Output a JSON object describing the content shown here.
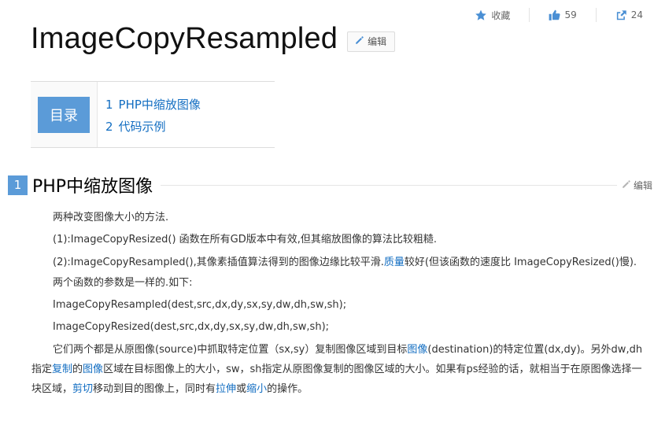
{
  "toolbar": {
    "collect_label": "收藏",
    "like_count": "59",
    "share_count": "24"
  },
  "title": "ImageCopyResampled",
  "edit_label": "编辑",
  "toc": {
    "label": "目录",
    "items": [
      {
        "num": "1",
        "text": "PHP中缩放图像"
      },
      {
        "num": "2",
        "text": "代码示例"
      }
    ]
  },
  "section": {
    "num": "1",
    "title": "PHP中缩放图像",
    "edit_label": "编辑"
  },
  "content": {
    "p1": "两种改变图像大小的方法.",
    "p2": "(1):ImageCopyResized() 函数在所有GD版本中有效,但其缩放图像的算法比较粗糙.",
    "p3a": "(2):ImageCopyResampled(),其像素插值算法得到的图像边缘比较平滑.",
    "p3_link": "质量",
    "p3b": "较好(但该函数的速度比 ImageCopyResized()慢).",
    "p4": "两个函数的参数是一样的.如下:",
    "p5": "ImageCopyResampled(dest,src,dx,dy,sx,sy,dw,dh,sw,sh);",
    "p6": "ImageCopyResized(dest,src,dx,dy,sx,sy,dw,dh,sw,sh);",
    "p7_t1": "它们两个都是从原图像(source)中抓取特定位置（sx,sy）复制图像区域到目标",
    "p7_l1": "图像",
    "p7_t2": "(destination)的特定位置(dx,dy)。另外dw,dh指定",
    "p7_l2": "复制",
    "p7_t3": "的",
    "p7_l3": "图像",
    "p7_t4": "区域在目标图像上的大小，sw，sh指定从原图像复制的图像区域的大小。如果有ps经验的话，就相当于在原图像选择一块区域，",
    "p7_l4": "剪切",
    "p7_t5": "移动到目的图像上，同时有",
    "p7_l5": "拉伸",
    "p7_t6": "或",
    "p7_l6": "缩小",
    "p7_t7": "的操作。"
  }
}
